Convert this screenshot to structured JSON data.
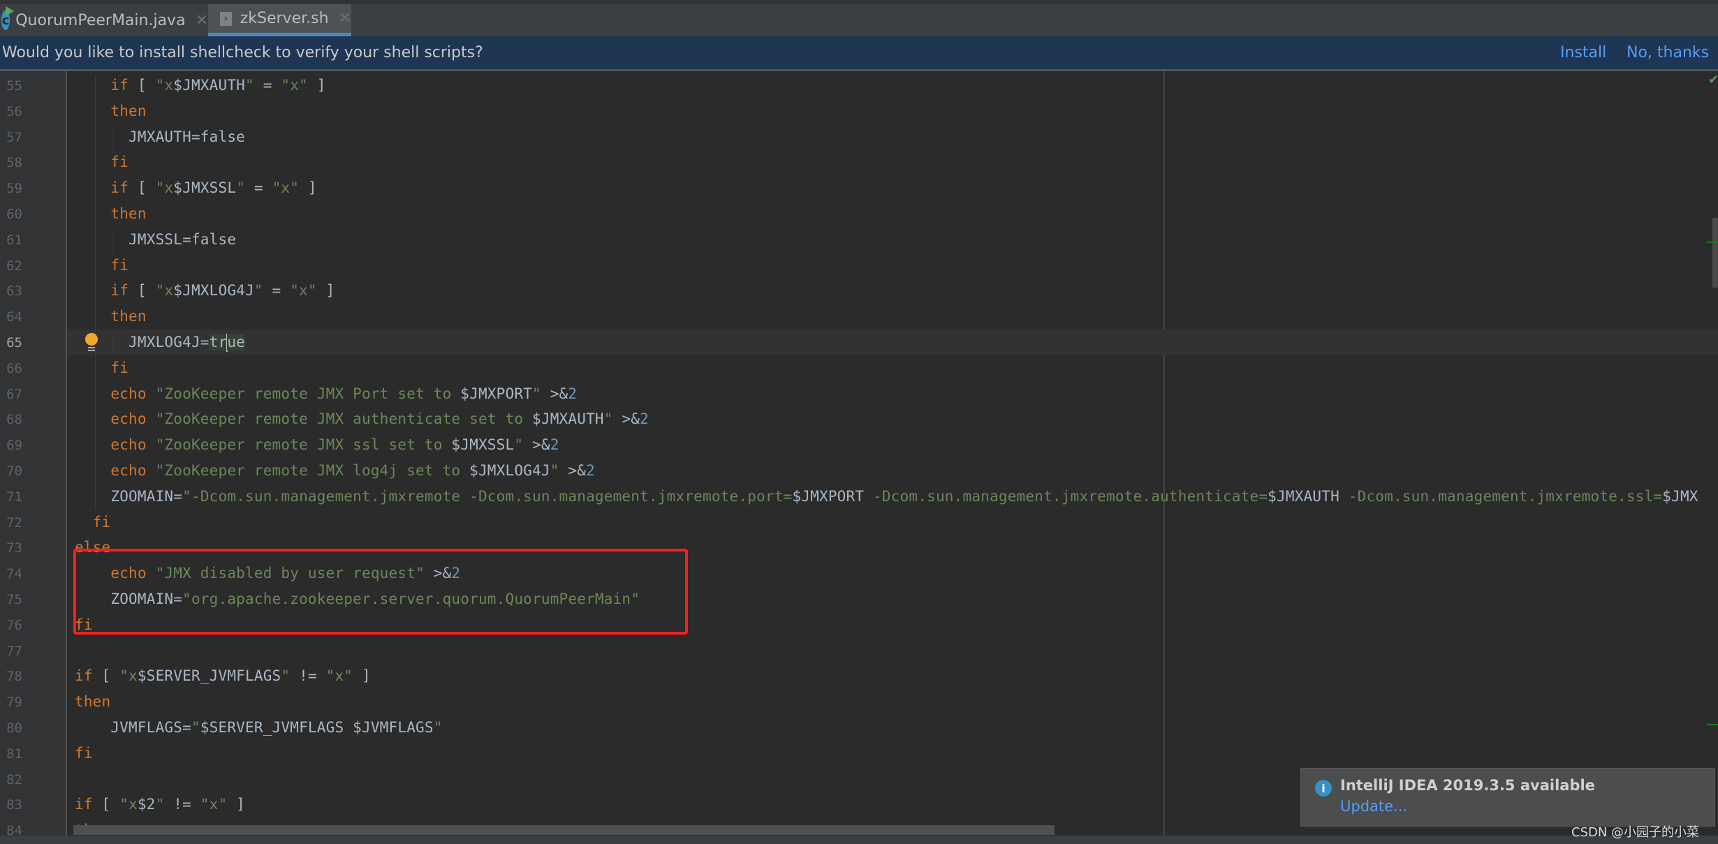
{
  "tabs": [
    {
      "label": "QuorumPeerMain.java",
      "icon": "java-class-icon",
      "active": false
    },
    {
      "label": "zkServer.sh",
      "icon": "shell-script-icon",
      "active": true
    }
  ],
  "banner": {
    "message": "Would you like to install shellcheck to verify your shell scripts?",
    "install_label": "Install",
    "dismiss_label": "No, thanks"
  },
  "editor": {
    "current_line": 65,
    "lines": [
      {
        "n": "55",
        "code": [
          [
            "    ",
            ""
          ],
          [
            "if",
            "kw"
          ],
          [
            " [ ",
            ""
          ],
          [
            "\"x",
            "str"
          ],
          [
            "$JMXAUTH",
            "var"
          ],
          [
            "\"",
            "str"
          ],
          [
            " = ",
            ""
          ],
          [
            "\"x\"",
            "str"
          ],
          [
            " ]",
            ""
          ]
        ]
      },
      {
        "n": "56",
        "code": [
          [
            "    ",
            ""
          ],
          [
            "then",
            "kw"
          ]
        ]
      },
      {
        "n": "57",
        "code": [
          [
            "      JMXAUTH=false",
            ""
          ]
        ]
      },
      {
        "n": "58",
        "code": [
          [
            "    ",
            ""
          ],
          [
            "fi",
            "kw"
          ]
        ]
      },
      {
        "n": "59",
        "code": [
          [
            "    ",
            ""
          ],
          [
            "if",
            "kw"
          ],
          [
            " [ ",
            ""
          ],
          [
            "\"x",
            "str"
          ],
          [
            "$JMXSSL",
            "var"
          ],
          [
            "\"",
            "str"
          ],
          [
            " = ",
            ""
          ],
          [
            "\"x\"",
            "str"
          ],
          [
            " ]",
            ""
          ]
        ]
      },
      {
        "n": "60",
        "code": [
          [
            "    ",
            ""
          ],
          [
            "then",
            "kw"
          ]
        ]
      },
      {
        "n": "61",
        "code": [
          [
            "      JMXSSL=false",
            ""
          ]
        ]
      },
      {
        "n": "62",
        "code": [
          [
            "    ",
            ""
          ],
          [
            "fi",
            "kw"
          ]
        ]
      },
      {
        "n": "63",
        "code": [
          [
            "    ",
            ""
          ],
          [
            "if",
            "kw"
          ],
          [
            " [ ",
            ""
          ],
          [
            "\"x",
            "str"
          ],
          [
            "$JMXLOG4J",
            "var"
          ],
          [
            "\"",
            "str"
          ],
          [
            " = ",
            ""
          ],
          [
            "\"x\"",
            "str"
          ],
          [
            " ]",
            ""
          ]
        ]
      },
      {
        "n": "64",
        "code": [
          [
            "    ",
            ""
          ],
          [
            "then",
            "kw"
          ]
        ]
      },
      {
        "n": "65",
        "code": [
          [
            "      JMXLOG4J=",
            ""
          ],
          [
            "tr",
            "hl"
          ],
          [
            "|",
            "caret"
          ],
          [
            "ue",
            "hl"
          ]
        ]
      },
      {
        "n": "66",
        "code": [
          [
            "    ",
            ""
          ],
          [
            "fi",
            "kw"
          ]
        ]
      },
      {
        "n": "67",
        "code": [
          [
            "    ",
            ""
          ],
          [
            "echo",
            "kw"
          ],
          [
            " ",
            ""
          ],
          [
            "\"ZooKeeper remote JMX Port set to ",
            "str"
          ],
          [
            "$JMXPORT",
            "var"
          ],
          [
            "\"",
            "str"
          ],
          [
            " >&",
            ""
          ],
          [
            "2",
            "num"
          ]
        ]
      },
      {
        "n": "68",
        "code": [
          [
            "    ",
            ""
          ],
          [
            "echo",
            "kw"
          ],
          [
            " ",
            ""
          ],
          [
            "\"ZooKeeper remote JMX authenticate set to ",
            "str"
          ],
          [
            "$JMXAUTH",
            "var"
          ],
          [
            "\"",
            "str"
          ],
          [
            " >&",
            ""
          ],
          [
            "2",
            "num"
          ]
        ]
      },
      {
        "n": "69",
        "code": [
          [
            "    ",
            ""
          ],
          [
            "echo",
            "kw"
          ],
          [
            " ",
            ""
          ],
          [
            "\"ZooKeeper remote JMX ssl set to ",
            "str"
          ],
          [
            "$JMXSSL",
            "var"
          ],
          [
            "\"",
            "str"
          ],
          [
            " >&",
            ""
          ],
          [
            "2",
            "num"
          ]
        ]
      },
      {
        "n": "70",
        "code": [
          [
            "    ",
            ""
          ],
          [
            "echo",
            "kw"
          ],
          [
            " ",
            ""
          ],
          [
            "\"ZooKeeper remote JMX log4j set to ",
            "str"
          ],
          [
            "$JMXLOG4J",
            "var"
          ],
          [
            "\"",
            "str"
          ],
          [
            " >&",
            ""
          ],
          [
            "2",
            "num"
          ]
        ]
      },
      {
        "n": "71",
        "code": [
          [
            "    ZOOMAIN=",
            ""
          ],
          [
            "\"-Dcom.sun.management.jmxremote -Dcom.sun.management.jmxremote.port=",
            "str"
          ],
          [
            "$JMXPORT",
            "var"
          ],
          [
            " -Dcom.sun.management.jmxremote.authenticate=",
            "str"
          ],
          [
            "$JMXAUTH",
            "var"
          ],
          [
            " -Dcom.sun.management.jmxremote.ssl=",
            "str"
          ],
          [
            "$JMX",
            "var"
          ]
        ]
      },
      {
        "n": "72",
        "code": [
          [
            "  ",
            ""
          ],
          [
            "fi",
            "kw"
          ]
        ]
      },
      {
        "n": "73",
        "code": [
          [
            "else",
            "kw"
          ]
        ]
      },
      {
        "n": "74",
        "code": [
          [
            "    ",
            ""
          ],
          [
            "echo",
            "kw"
          ],
          [
            " ",
            ""
          ],
          [
            "\"JMX disabled by user request\"",
            "str"
          ],
          [
            " >&",
            ""
          ],
          [
            "2",
            "num"
          ]
        ]
      },
      {
        "n": "75",
        "code": [
          [
            "    ZOOMAIN=",
            ""
          ],
          [
            "\"org.apache.zookeeper.server.quorum.QuorumPeerMain\"",
            "str"
          ]
        ]
      },
      {
        "n": "76",
        "code": [
          [
            "fi",
            "kw"
          ]
        ]
      },
      {
        "n": "77",
        "code": []
      },
      {
        "n": "78",
        "code": [
          [
            "if",
            "kw"
          ],
          [
            " [ ",
            ""
          ],
          [
            "\"x",
            "str"
          ],
          [
            "$SERVER_JVMFLAGS",
            "var"
          ],
          [
            "\"",
            "str"
          ],
          [
            " != ",
            ""
          ],
          [
            "\"x\"",
            "str"
          ],
          [
            " ]",
            ""
          ]
        ]
      },
      {
        "n": "79",
        "code": [
          [
            "then",
            "kw"
          ]
        ]
      },
      {
        "n": "80",
        "code": [
          [
            "    JVMFLAGS=",
            ""
          ],
          [
            "\"",
            "str"
          ],
          [
            "$SERVER_JVMFLAGS $JVMFLAGS",
            "var"
          ],
          [
            "\"",
            "str"
          ]
        ]
      },
      {
        "n": "81",
        "code": [
          [
            "fi",
            "kw"
          ]
        ]
      },
      {
        "n": "82",
        "code": []
      },
      {
        "n": "83",
        "code": [
          [
            "if",
            "kw"
          ],
          [
            " [ ",
            ""
          ],
          [
            "\"x",
            "str"
          ],
          [
            "$2",
            "var"
          ],
          [
            "\"",
            "str"
          ],
          [
            " != ",
            ""
          ],
          [
            "\"x\"",
            "str"
          ],
          [
            " ]",
            ""
          ]
        ]
      },
      {
        "n": "84",
        "code": [
          [
            "then",
            "kw"
          ]
        ]
      }
    ]
  },
  "notification": {
    "icon": "info-icon",
    "title": "IntelliJ IDEA 2019.3.5 available",
    "action_label": "Update..."
  },
  "watermark": "CSDN @小园子的小菜",
  "colors": {
    "keyword": "#cc7832",
    "string": "#6a8759",
    "number": "#6897bb",
    "text": "#a9b7c6",
    "link": "#589df6",
    "banner_bg": "#1e3653",
    "annotation_box": "#ff1e1e"
  }
}
